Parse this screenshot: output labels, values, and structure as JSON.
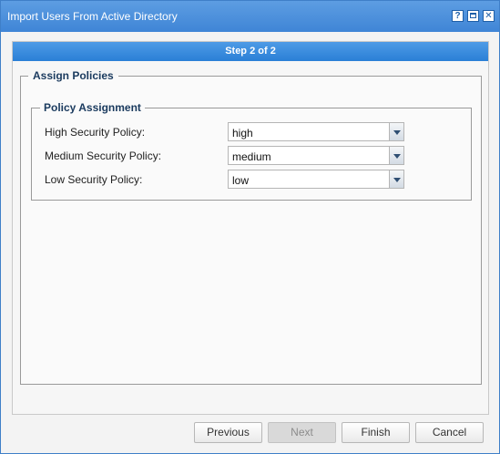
{
  "window": {
    "title": "Import Users From Active Directory",
    "help_label": "?",
    "close_label": "✕"
  },
  "wizard": {
    "step_label": "Step 2 of 2"
  },
  "assign_policies": {
    "legend": "Assign Policies",
    "policy_assignment": {
      "legend": "Policy Assignment",
      "rows": [
        {
          "label": "High Security Policy:",
          "value": "high"
        },
        {
          "label": "Medium Security Policy:",
          "value": "medium"
        },
        {
          "label": "Low Security Policy:",
          "value": "low"
        }
      ]
    }
  },
  "buttons": {
    "previous": "Previous",
    "next": "Next",
    "finish": "Finish",
    "cancel": "Cancel",
    "next_enabled": false
  },
  "colors": {
    "title_bar": "#3f85d6",
    "step_bar": "#2a7fd6",
    "legend_text": "#1a3a5e"
  }
}
